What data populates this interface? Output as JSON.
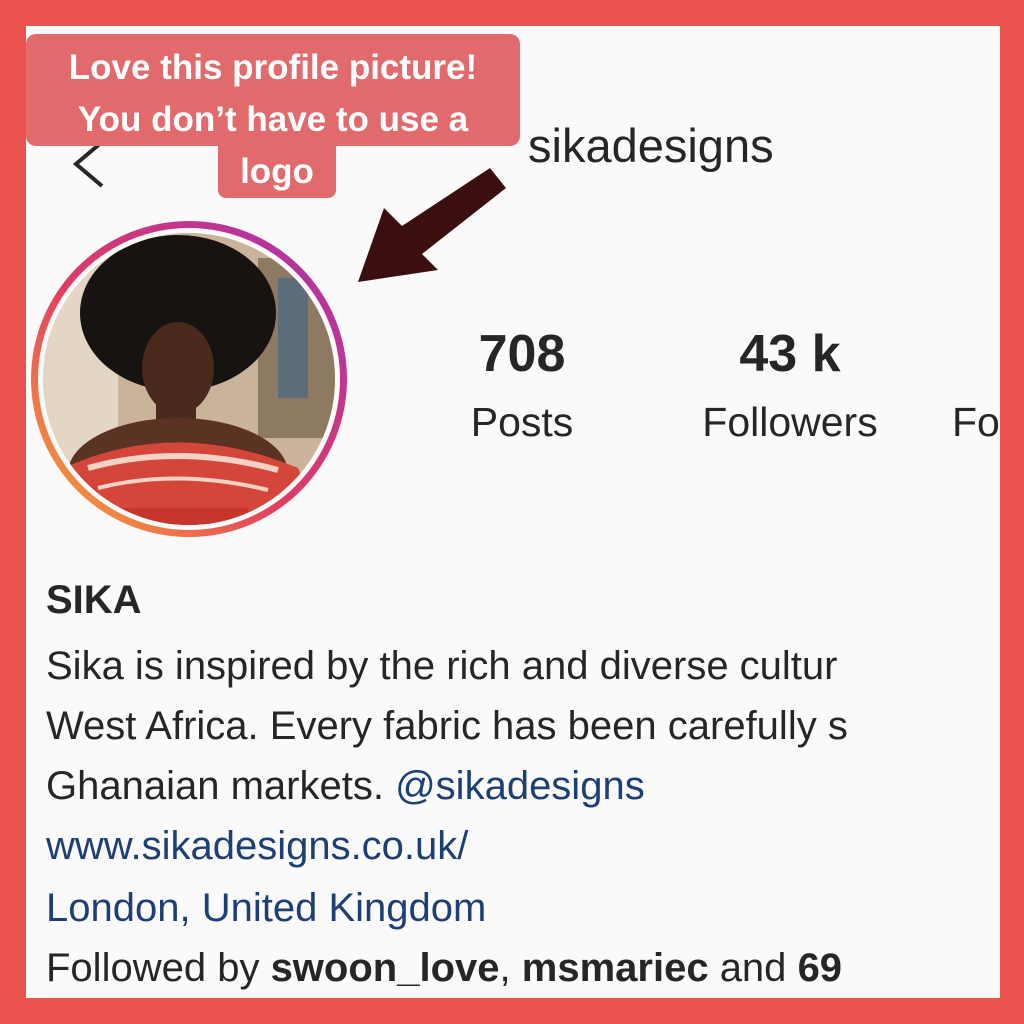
{
  "profile": {
    "username": "sikadesigns",
    "posts_count": "708",
    "posts_label": "Posts",
    "followers_count": "43 k",
    "followers_label": "Followers",
    "following_label_partial": "Fo"
  },
  "bio": {
    "name": "SIKA",
    "line1": "Sika is inspired by the rich and diverse cultur",
    "line2": "West Africa. Every fabric has been carefully s",
    "line3_text": "Ghanaian markets.",
    "line3_mention": "@sikadesigns",
    "website": "www.sikadesigns.co.uk/",
    "location": "London, United Kingdom",
    "followed_by_prefix": "Followed by",
    "followed_user1": "swoon_love",
    "followed_sep": ",",
    "followed_user2": "msmariec",
    "followed_and": "and",
    "followed_count": "69"
  },
  "annotation": {
    "line1": "Love this profile picture!",
    "line2": "You don’t have to use a",
    "line3": "logo"
  },
  "colors": {
    "frame": "#e9524f",
    "callout": "#e06a6c",
    "link": "#1d3f73",
    "arrow": "#3b0f0f"
  },
  "icons": {
    "back": "chevron-left-icon",
    "arrow": "arrow-annotation-icon",
    "avatar": "profile-avatar"
  }
}
